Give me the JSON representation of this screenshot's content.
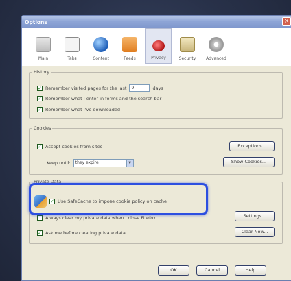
{
  "window": {
    "title": "Options",
    "close_glyph": "×"
  },
  "toolbar": {
    "items": [
      {
        "label": "Main",
        "icon": "main-icon"
      },
      {
        "label": "Tabs",
        "icon": "tabs-icon"
      },
      {
        "label": "Content",
        "icon": "content-icon"
      },
      {
        "label": "Feeds",
        "icon": "feeds-icon"
      },
      {
        "label": "Privacy",
        "icon": "privacy-icon",
        "active": true
      },
      {
        "label": "Security",
        "icon": "security-icon"
      },
      {
        "label": "Advanced",
        "icon": "advanced-icon"
      }
    ]
  },
  "history": {
    "legend": "History",
    "remember_visited_prefix": "Remember visited pages for the last",
    "days_value": "9",
    "days_suffix": "days",
    "remember_forms": "Remember what I enter in forms and the search bar",
    "remember_downloads": "Remember what I've downloaded"
  },
  "cookies": {
    "legend": "Cookies",
    "accept": "Accept cookies from sites",
    "keep_until_label": "Keep until:",
    "keep_until_value": "they expire",
    "exceptions_button": "Exceptions...",
    "show_cookies_button": "Show Cookies..."
  },
  "private_data": {
    "legend": "Private Data",
    "safecache": "Use SafeCache to impose cookie policy on cache",
    "always_clear": "Always clear my private data when I close Firefox",
    "ask_before": "Ask me before clearing private data",
    "settings_button": "Settings...",
    "clear_now_button": "Clear Now..."
  },
  "footer": {
    "ok": "OK",
    "cancel": "Cancel",
    "help": "Help"
  },
  "colors": {
    "highlight": "#2d4fe0",
    "check": "#2a8a2a"
  }
}
